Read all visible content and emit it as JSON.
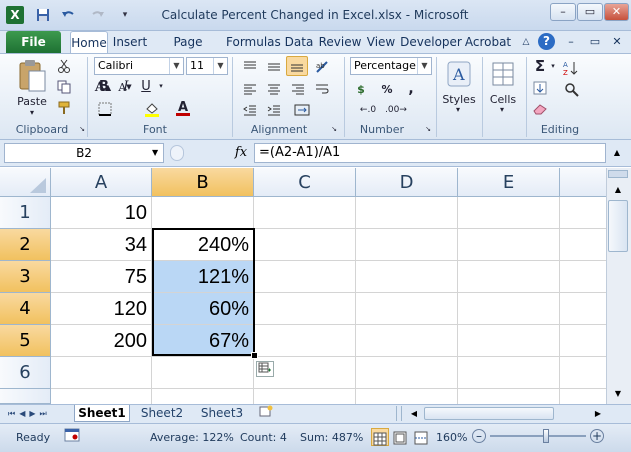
{
  "window": {
    "title": "Calculate Percent Changed in Excel.xlsx - Microsoft Excel",
    "controls": {
      "minimize": "–",
      "restore": "▭",
      "close": "✕"
    }
  },
  "qat": {
    "save_icon": "floppy-disk-icon",
    "undo_icon": "undo-icon",
    "redo_icon": "redo-icon"
  },
  "tabs": [
    "File",
    "Home",
    "Insert",
    "Page Layout",
    "Formulas",
    "Data",
    "Review",
    "View",
    "Developer",
    "Acrobat"
  ],
  "ribbon": {
    "clipboard": {
      "label": "Clipboard",
      "paste": "Paste"
    },
    "font": {
      "label": "Font",
      "name": "Calibri",
      "size": "11",
      "bold": "B",
      "italic": "I",
      "underline": "U",
      "font_color": "#c00000",
      "fill_color": "#ffff00"
    },
    "alignment": {
      "label": "Alignment"
    },
    "number": {
      "label": "Number",
      "format": "Percentage",
      "currency": "$",
      "percent": "%",
      "comma": ","
    },
    "styles": {
      "label": "Styles"
    },
    "cells": {
      "label": "Cells"
    },
    "editing": {
      "label": "Editing",
      "sum_icon": "Σ"
    }
  },
  "formula_bar": {
    "name_box": "B2",
    "fx": "fx",
    "formula": "=(A2-A1)/A1"
  },
  "grid": {
    "columns": [
      "A",
      "B",
      "C",
      "D",
      "E"
    ],
    "selected_column": "B",
    "rows": [
      {
        "num": "1",
        "a": "10",
        "b": ""
      },
      {
        "num": "2",
        "a": "34",
        "b": "240%"
      },
      {
        "num": "3",
        "a": "75",
        "b": "121%"
      },
      {
        "num": "4",
        "a": "120",
        "b": "60%"
      },
      {
        "num": "5",
        "a": "200",
        "b": "67%"
      },
      {
        "num": "6",
        "a": "",
        "b": ""
      }
    ]
  },
  "sheets": [
    "Sheet1",
    "Sheet2",
    "Sheet3"
  ],
  "status": {
    "ready": "Ready",
    "average": "Average: 122%",
    "count": "Count: 4",
    "sum": "Sum: 487%",
    "zoom": "160%"
  },
  "colors": {
    "selection": "#bad7f5",
    "header_selected": "#f1c15f",
    "file_tab": "#1e7133"
  }
}
